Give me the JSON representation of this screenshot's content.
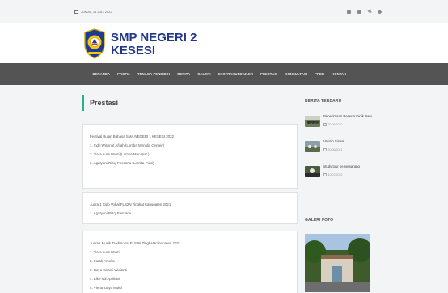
{
  "topbar": {
    "date": "JUMAT, 15 JULI 2022",
    "icons": [
      "mail-icon",
      "home-icon",
      "phone-icon",
      "settings-icon"
    ]
  },
  "header": {
    "school_name_line1": "SMP NEGERI 2",
    "school_name_line2": "KESESI",
    "brand_color": "#22388a"
  },
  "nav": {
    "items": [
      "BERANDA",
      "PROFIL",
      "TENAGA PENDIDIK",
      "BERITA",
      "GALERI",
      "EKSTRAKURIKULER",
      "PRESTASI",
      "KONSULTASI",
      "PPDB",
      "KONTAK"
    ]
  },
  "main": {
    "title": "Prestasi",
    "accent_color": "#2bb08a",
    "cards": [
      {
        "lines": [
          "Festival Bulan Bahasa SMA NEGERI 1 KESESI 2022",
          "1. Indri Wisenut Afifah (Lomba Menulis Cerpen)",
          "2. Tiara Aura Mukti (Lomba Macapat )",
          "3. Agatyani Rizqi Fierdana (Lomba Puisi)"
        ]
      },
      {
        "lines": [
          "Juara 1 Solo Vokal FLS2N Tingkat Kabupaten 2021",
          "1. Agatyani Rizqi Fierdana"
        ]
      },
      {
        "lines": [
          "Juara I Musik Tradisional FLS2N Tingkat Kabupaten 2021",
          "1. Tiara Aura Mukti",
          "2. Farah Amelia",
          "3. Rayu Isnaini Widianti",
          "4. Elk Fitdi Apriliani",
          "5. Viena Zulya Mukti"
        ]
      }
    ]
  },
  "sidebar": {
    "news_heading": "BERITA TERBARU",
    "news": [
      {
        "title": "Penerimaan Peserta Didik Baru",
        "date": "20/06/2022"
      },
      {
        "title": "Vaksin Siswa",
        "date": "20/06/2021"
      },
      {
        "title": "study tour ke semarang",
        "date": "10/07/2022"
      }
    ],
    "gallery_heading": "GALERI FOTO"
  }
}
